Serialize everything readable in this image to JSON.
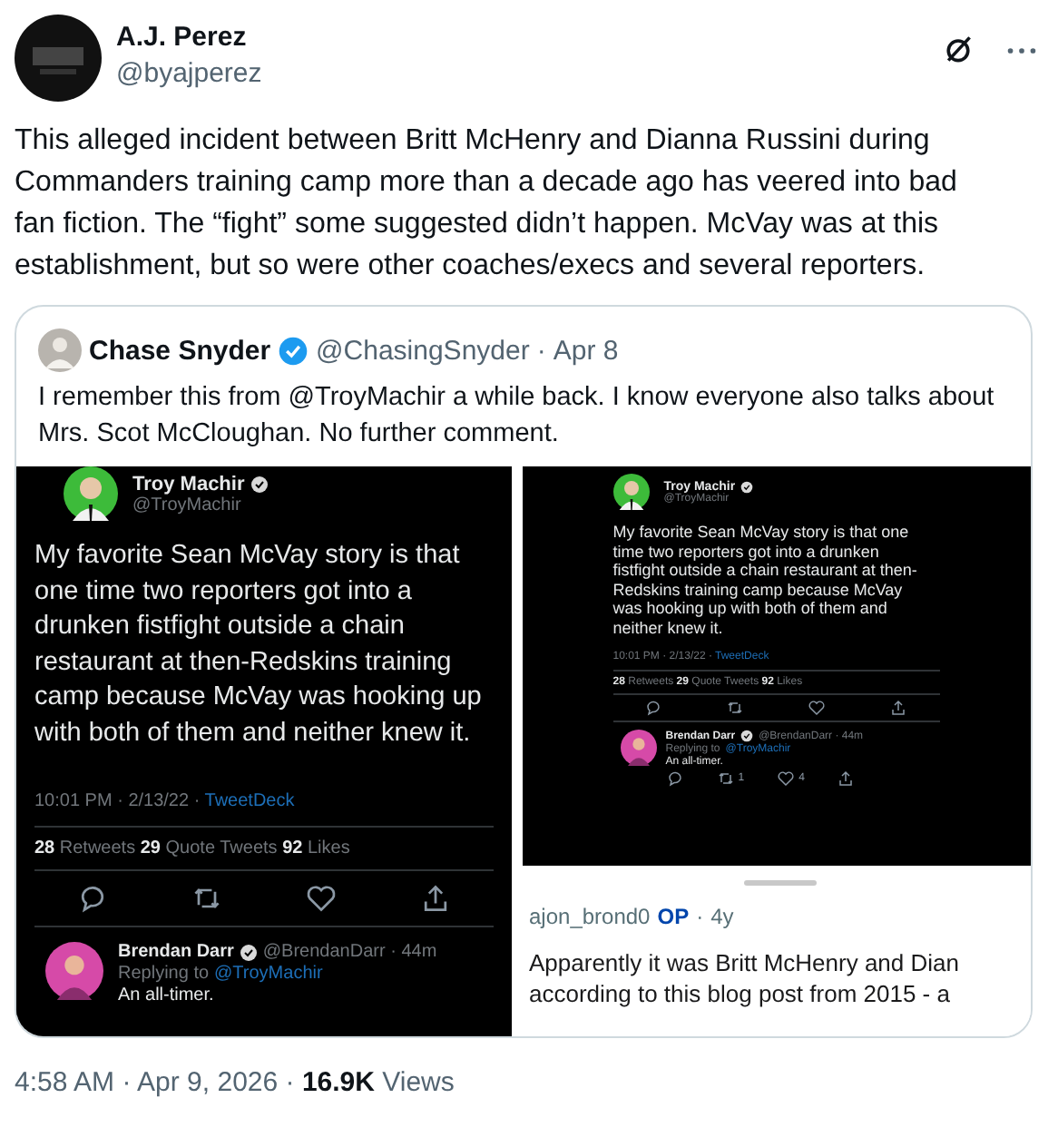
{
  "post": {
    "author": {
      "name": "A.J. Perez",
      "handle": "@byajperez"
    },
    "text": "This alleged incident between Britt McHenry and Dianna Russini during Commanders training camp more than a decade ago has veered into bad fan fiction. The “fight” some suggested didn’t happen. McVay was at this establishment, but so were other coaches/execs and several reporters.",
    "quote": {
      "author": {
        "name": "Chase Snyder",
        "verified": true,
        "handle": "@ChasingSnyder",
        "separator": "·",
        "date": "Apr 8"
      },
      "text": "I remember this from @TroyMachir a while back. I know everyone also talks about Mrs. Scot McCloughan. No further comment.",
      "images": [
        {
          "kind": "tweet",
          "tweet": {
            "name": "Troy Machir",
            "verified": true,
            "handle": "@TroyMachir",
            "text": "My favorite Sean McVay story is that one time two reporters got into a drunken fistfight outside a chain restaurant at then-Redskins training camp because McVay was hooking up with both of them and neither knew it.",
            "meta": "10:01 PM · 2/13/22 · ",
            "source": "TweetDeck",
            "stats": "**28** Retweets **29** Quote Tweets **92** Likes",
            "actions": [
              {
                "kind": "reply"
              },
              {
                "kind": "retweet"
              },
              {
                "kind": "like"
              },
              {
                "kind": "share"
              }
            ],
            "reply": {
              "name": "Brendan Darr",
              "verified": true,
              "handle_time": "@BrendanDarr · 44m",
              "replying": "Replying to",
              "replying_to": "@TroyMachir",
              "text": "An all-timer."
            }
          }
        },
        {
          "kind": "phone",
          "tweet": {
            "name": "Troy Machir",
            "verified": true,
            "handle": "@TroyMachir",
            "text": "My favorite Sean McVay story is that one time two reporters got into a drunken fistfight outside a chain restaurant at then-Redskins training camp because McVay was hooking up with both of them and neither knew it.",
            "meta": "10:01 PM · 2/13/22 · ",
            "source": "TweetDeck",
            "stats": "**28** Retweets **29** Quote Tweets **92** Likes",
            "actions": [
              {
                "kind": "reply"
              },
              {
                "kind": "retweet"
              },
              {
                "kind": "like"
              },
              {
                "kind": "share"
              }
            ],
            "reply": {
              "name": "Brendan Darr",
              "verified": true,
              "handle_time": "@BrendanDarr · 44m",
              "replying": "Replying to",
              "replying_to": "@TroyMachir",
              "text": "An all-timer.",
              "actions": [
                {
                  "kind": "reply"
                },
                {
                  "kind": "retweet",
                  "count": "1"
                },
                {
                  "kind": "like",
                  "count": "4"
                },
                {
                  "kind": "share"
                }
              ]
            }
          },
          "comment": {
            "user": "ajon_brond0",
            "badge": "OP",
            "separator": "·",
            "age": "4y",
            "lines": [
              "Apparently it was Britt McHenry and Dian",
              "according to this blog post from 2015 - a"
            ]
          }
        }
      ]
    },
    "footer": "4:58 AM · Apr 9, 2026 · **16.9K** Views"
  }
}
